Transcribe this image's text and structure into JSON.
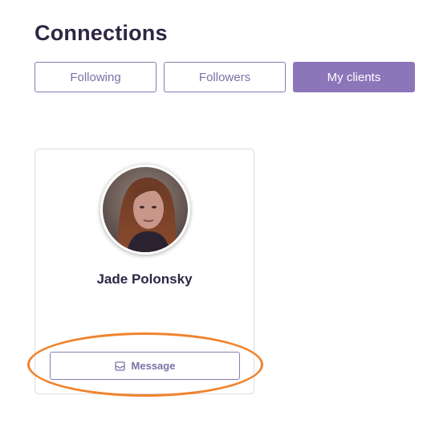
{
  "header": {
    "title": "Connections"
  },
  "tabs": [
    {
      "label": "Following",
      "active": false
    },
    {
      "label": "Followers",
      "active": false
    },
    {
      "label": "My clients",
      "active": true
    }
  ],
  "clients": [
    {
      "name": "Jade Polonsky",
      "message_label": "Message",
      "avatar_icon": "profile-photo"
    }
  ],
  "colors": {
    "accent": "#8c75b9",
    "title": "#2e2643",
    "highlight": "#f0832d"
  }
}
